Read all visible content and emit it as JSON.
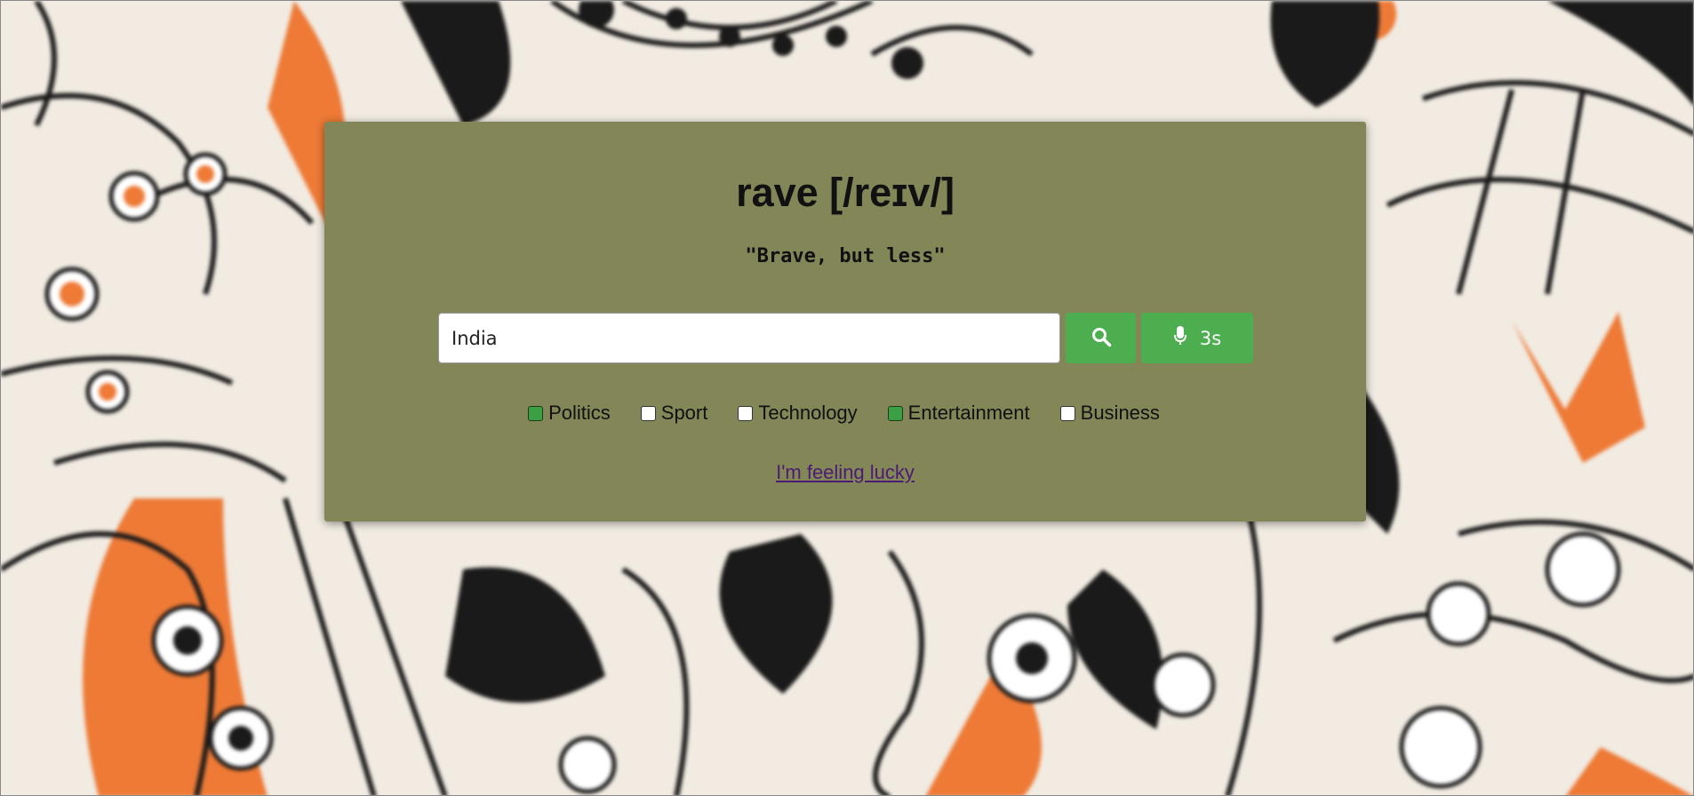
{
  "header": {
    "title": "rave [/reɪv/]",
    "tagline": "\"Brave, but less\""
  },
  "search": {
    "value": "India",
    "search_icon": "search-icon",
    "voice_icon": "microphone-icon",
    "voice_label": "3s"
  },
  "categories": [
    {
      "label": "Politics",
      "checked": true
    },
    {
      "label": "Sport",
      "checked": false
    },
    {
      "label": "Technology",
      "checked": false
    },
    {
      "label": "Entertainment",
      "checked": true
    },
    {
      "label": "Business",
      "checked": false
    }
  ],
  "lucky_link": "I'm feeling lucky",
  "colors": {
    "panel": "#838657",
    "button": "#4cae4f",
    "checkbox_checked": "#3aa043",
    "link": "#4b1c73",
    "background_accent": "#ee7a36"
  }
}
